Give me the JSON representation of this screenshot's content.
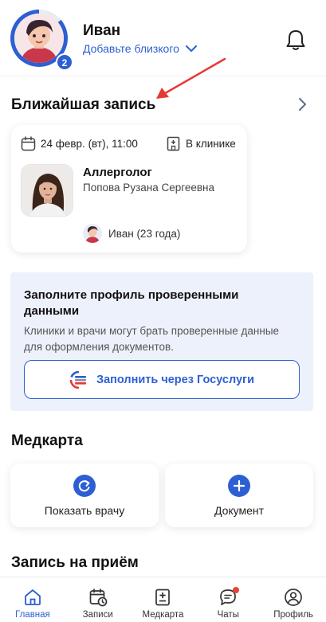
{
  "header": {
    "user_name": "Иван",
    "add_close_label": "Добавьте близкого",
    "avatar_badge": "2"
  },
  "upcoming": {
    "title": "Ближайшая запись",
    "date": "24 февр. (вт), 11:00",
    "place": "В клинике",
    "specialty": "Аллерголог",
    "doctor_name": "Попова Рузана Сергеевна",
    "patient": "Иван (23 года)"
  },
  "profile_fill": {
    "title": "Заполните профиль проверенными данными",
    "description": "Клиники и врачи могут брать проверенные данные для оформления документов.",
    "button_label": "Заполнить через Госуслуги"
  },
  "medcard": {
    "title": "Медкарта",
    "tiles": [
      {
        "label": "Показать врачу",
        "icon": "share-icon"
      },
      {
        "label": "Документ",
        "icon": "plus-icon"
      }
    ]
  },
  "booking": {
    "title": "Запись на приём"
  },
  "nav": {
    "items": [
      {
        "label": "Главная",
        "icon": "home-icon",
        "active": true
      },
      {
        "label": "Записи",
        "icon": "calendar-clock-icon",
        "active": false
      },
      {
        "label": "Медкарта",
        "icon": "medcard-icon",
        "active": false
      },
      {
        "label": "Чаты",
        "icon": "chat-icon",
        "active": false
      },
      {
        "label": "Профиль",
        "icon": "profile-icon",
        "active": false
      }
    ]
  },
  "colors": {
    "accent": "#2d5fd3",
    "annotation": "#e53935",
    "card_bg": "#edf1fb",
    "notification_dot": "#e8433b"
  }
}
